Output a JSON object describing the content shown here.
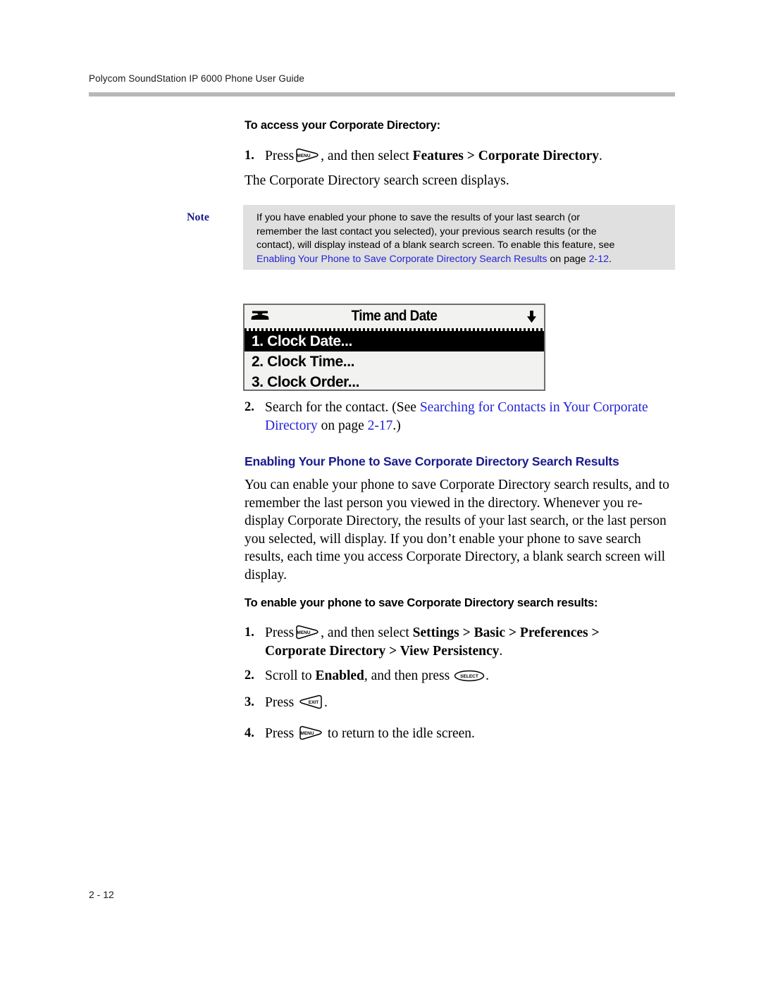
{
  "header": {
    "running_head": "Polycom SoundStation IP 6000 Phone User Guide"
  },
  "footer": {
    "folio": "2 - 12"
  },
  "section_access": {
    "heading": "To access your Corporate Directory:",
    "step1": {
      "number": "1.",
      "text_before_key": "Press",
      "key": "MENU",
      "text_after_key": ", and then select ",
      "bold_path": "Features > Corporate Directory",
      "trailing": "."
    },
    "step1_result": "The Corporate Directory search screen displays.",
    "step2": {
      "number": "2.",
      "lead": "Search for the contact. (See ",
      "link": "Searching for Contacts in Your Corporate Directory",
      "mid": " on page ",
      "page_link": "2-17",
      "trailing": ".)"
    }
  },
  "note": {
    "label": "Note",
    "line1": "If you have enabled your phone to save the results of your last search (or",
    "line2": "remember the last contact you selected), your previous search results (or the",
    "line3": "contact), will display instead of a blank search screen. To enable this feature, see",
    "link": "Enabling Your Phone to Save Corporate Directory Search Results",
    "mid": " on page ",
    "page_link": "2-12",
    "trailing": ".",
    "background": "#e0e0e0",
    "label_color": "#1b1b8f",
    "link_color": "#2323d8"
  },
  "lcd": {
    "title": "Time and Date",
    "handset_icon": "phone-handset-icon",
    "scroll_icon": "down-arrow-icon",
    "rows": [
      {
        "label": "1. Clock Date...",
        "selected": true
      },
      {
        "label": "2. Clock Time...",
        "selected": false
      },
      {
        "label": "3. Clock Order...",
        "selected": false
      }
    ]
  },
  "section_enable": {
    "heading": "Enabling Your Phone to Save Corporate Directory Search Results",
    "heading_color": "#1b1b8f",
    "paragraph": "You can enable your phone to save Corporate Directory search results, and to remember the last person you viewed in the directory. Whenever you re-display Corporate Directory, the results of your last search, or the last person you selected, will display. If you don’t enable your phone to save search results, each time you access Corporate Directory, a blank search screen will display.",
    "proc_heading": "To enable your phone to save Corporate Directory search results:",
    "step1": {
      "number": "1.",
      "text_before_key": "Press",
      "key": "MENU",
      "text_after_key": ", and then select ",
      "bold_path_line1": "Settings > Basic > Preferences >",
      "bold_path_line2": "Corporate Directory > View Persistency",
      "trailing": "."
    },
    "step2": {
      "number": "2.",
      "lead": "Scroll to ",
      "bold": "Enabled",
      "mid": ", and then press ",
      "key": "SELECT",
      "trailing": "."
    },
    "step3": {
      "number": "3.",
      "lead": "Press ",
      "key": "EXIT",
      "trailing": "."
    },
    "step4": {
      "number": "4.",
      "lead": "Press ",
      "key": "MENU",
      "trailing": " to return to the idle screen."
    }
  }
}
